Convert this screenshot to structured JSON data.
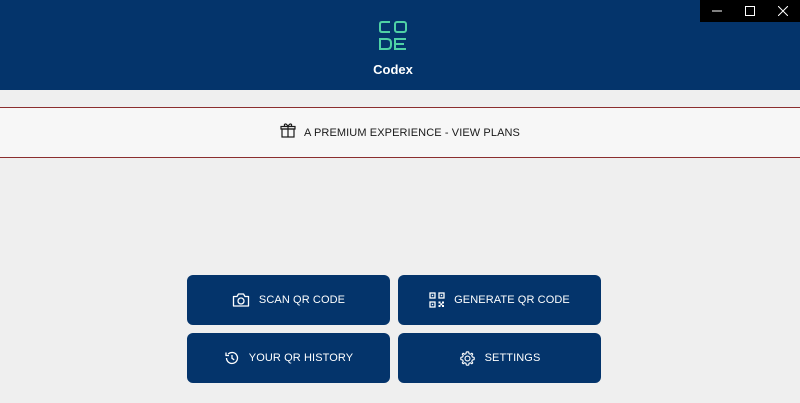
{
  "header": {
    "app_title": "Codex",
    "background_color": "#04346b",
    "logo_icon": "codex-logo"
  },
  "window_controls": {
    "minimize_icon": "minimize-icon",
    "maximize_icon": "maximize-icon",
    "close_icon": "close-icon"
  },
  "premium_banner": {
    "text": "A PREMIUM EXPERIENCE - VIEW PLANS",
    "icon": "gift-icon",
    "border_color": "#8b2e2e"
  },
  "actions": {
    "scan": {
      "label": "SCAN QR CODE",
      "icon": "camera-icon"
    },
    "generate": {
      "label": "GENERATE QR CODE",
      "icon": "qr-code-icon"
    },
    "history": {
      "label": "YOUR QR HISTORY",
      "icon": "history-icon"
    },
    "settings": {
      "label": "SETTINGS",
      "icon": "gear-icon"
    }
  }
}
